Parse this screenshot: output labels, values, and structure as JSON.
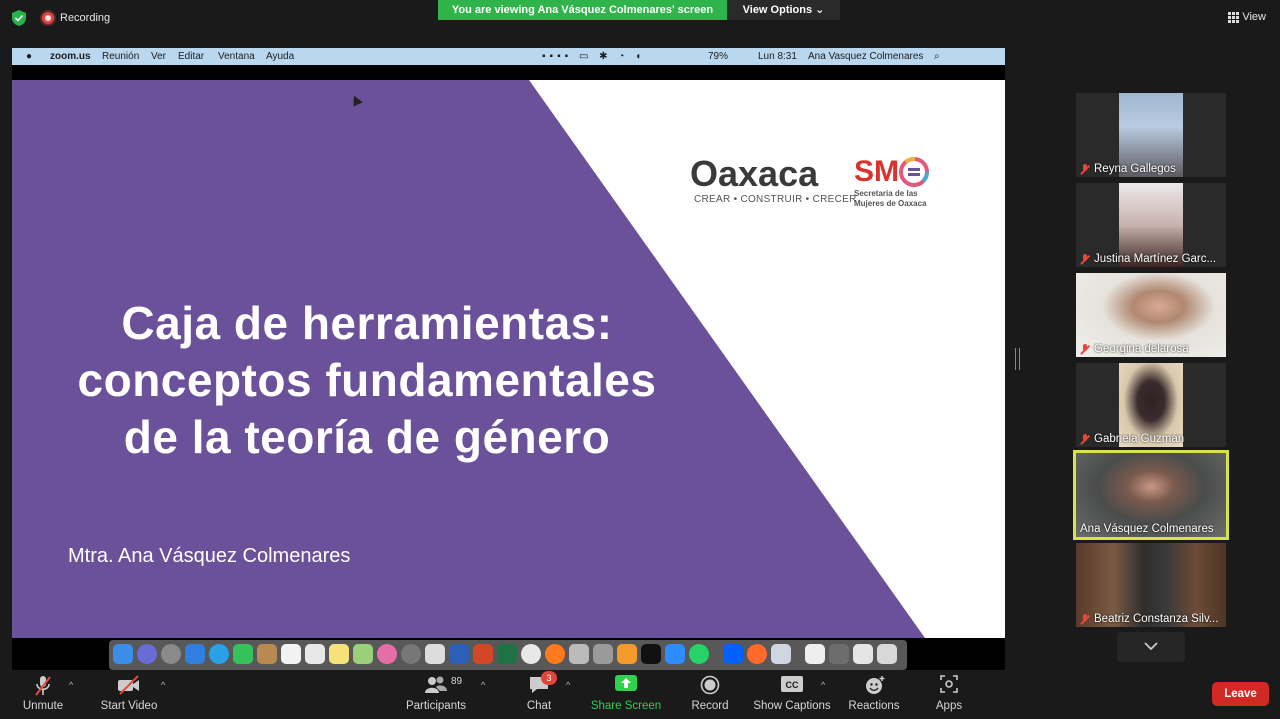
{
  "top_bar": {
    "recording_label": "Recording",
    "viewing_banner": "You are viewing Ana Vásquez Colmenares' screen",
    "view_options_label": "View Options ⌄",
    "view_label": "View"
  },
  "mac_menubar": {
    "apple": "",
    "app": "zoom.us",
    "menus": [
      "Reunión",
      "Ver",
      "Editar",
      "Ventana",
      "Ayuda"
    ],
    "battery": "79%",
    "clock": "Lun 8:31",
    "user": "Ana Vasquez Colmenares"
  },
  "slide": {
    "title_line1": "Caja de  herramientas:",
    "title_line2": "conceptos  fundamentales",
    "title_line3": "de  la  teoría  de  género",
    "author": "Mtra. Ana Vásquez Colmenares",
    "logo_oaxaca": "Oaxaca",
    "logo_oaxaca_tag": "CREAR • CONSTRUIR • CRECER",
    "logo_sm": "SM",
    "logo_sm_tag_1": "Secretaría de las",
    "logo_sm_tag_2": "Mujeres de Oaxaca",
    "colors": {
      "purple": "#6a519a",
      "white": "#ffffff"
    }
  },
  "participants": [
    {
      "name": "Reyna Gallegos",
      "muted": true
    },
    {
      "name": "Justina Martínez Garc...",
      "muted": true
    },
    {
      "name": "Georgina delarosa",
      "muted": true
    },
    {
      "name": "Gabriela Guzmán",
      "muted": true
    },
    {
      "name": "Ana Vásquez Colmenares",
      "muted": false,
      "active_speaker": true
    },
    {
      "name": "Beatriz Constanza Silv...",
      "muted": true
    }
  ],
  "toolbar": {
    "unmute": "Unmute",
    "start_video": "Start Video",
    "participants": "Participants",
    "participants_count": "89",
    "chat": "Chat",
    "chat_badge": "3",
    "share_screen": "Share Screen",
    "record": "Record",
    "show_captions": "Show Captions",
    "reactions": "Reactions",
    "apps": "Apps",
    "leave": "Leave"
  },
  "icons": {
    "security": "shield-icon",
    "grid": "grid-icon",
    "collapse": "chevron-down-icon"
  }
}
